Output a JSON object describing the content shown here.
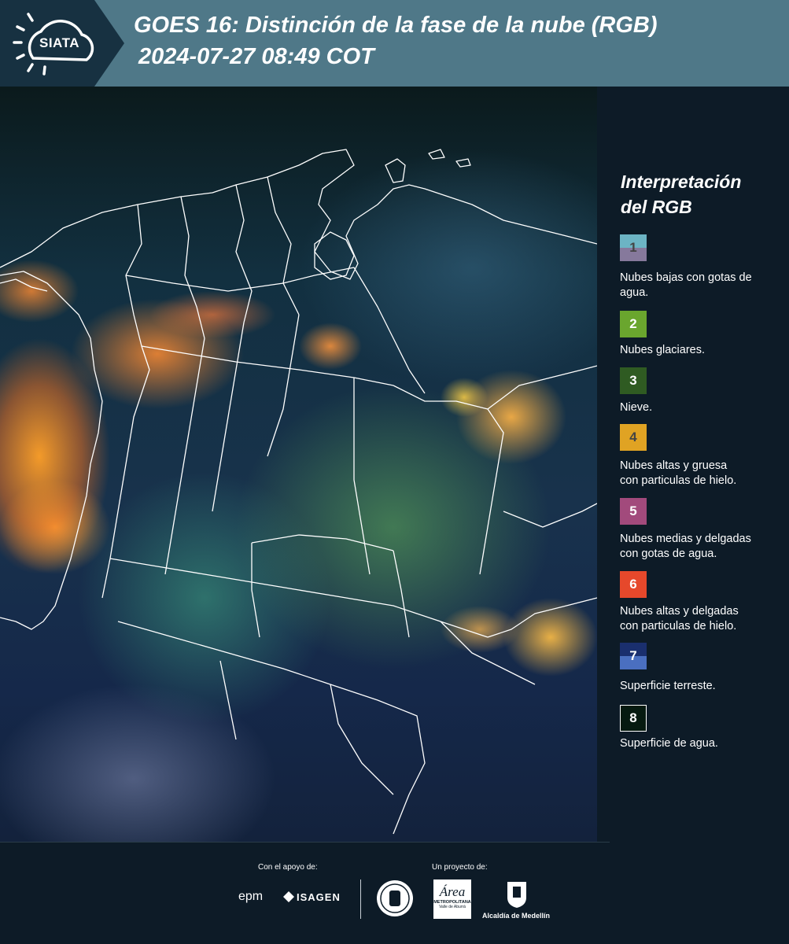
{
  "header": {
    "logo_text": "SIATA",
    "title_line1": "GOES 16: Distinción de la fase de la nube (RGB)",
    "title_line2": "2024-07-27 08:49 COT",
    "bg_color": "#4f7888",
    "logo_bg_color": "#173141"
  },
  "legend": {
    "title_line1": "Interpretación",
    "title_line2": "del RGB",
    "items": [
      {
        "num": "1",
        "label_line1": "Nubes bajas con gotas de",
        "label_line2": "agua.",
        "color_top": "#6cb4c4",
        "color_bottom": "#86799c"
      },
      {
        "num": "2",
        "label_line1": "Nubes glaciares.",
        "label_line2": "",
        "color_top": "#6aa62e",
        "color_bottom": "#6aa62e"
      },
      {
        "num": "3",
        "label_line1": "Nieve.",
        "label_line2": "",
        "color_top": "#2f5b22",
        "color_bottom": "#2f5b22"
      },
      {
        "num": "4",
        "label_line1": "Nubes altas y gruesa",
        "label_line2": "con particulas de hielo.",
        "color_top": "#e0a323",
        "color_bottom": "#e0a323"
      },
      {
        "num": "5",
        "label_line1": "Nubes medias y delgadas",
        "label_line2": "con gotas de agua.",
        "color_top": "#a24a7c",
        "color_bottom": "#a24a7c"
      },
      {
        "num": "6",
        "label_line1": "Nubes altas y delgadas",
        "label_line2": "con particulas de hielo.",
        "color_top": "#e6482b",
        "color_bottom": "#e6482b"
      },
      {
        "num": "7",
        "label_line1": "Superficie terreste.",
        "label_line2": "",
        "color_top": "#1a2f6e",
        "color_bottom": "#4a6fc0"
      },
      {
        "num": "8",
        "label_line1": "Superficie de agua.",
        "label_line2": "",
        "color_top": "#061a10",
        "color_bottom": "#061a10"
      }
    ]
  },
  "footer": {
    "support_label": "Con el apoyo de:",
    "project_label": "Un proyecto de:",
    "sponsor1": "epm",
    "sponsor2": "ISAGEN",
    "partner1_line1": "Área",
    "partner1_line2": "METROPOLITANA",
    "partner1_line3": "Valle de Aburrá",
    "partner2": "Alcaldía de Medellín"
  }
}
